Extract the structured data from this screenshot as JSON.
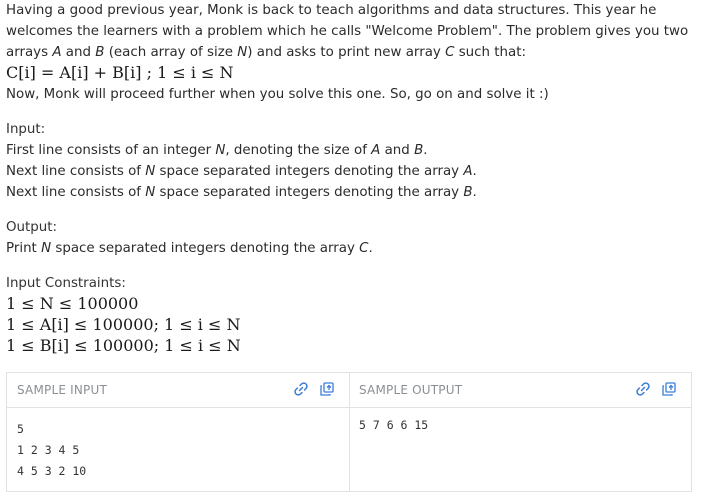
{
  "statement": {
    "line1": "Having a good previous year, Monk is back to teach algorithms and data structures. This year he",
    "line2": "welcomes the learners with a problem which he calls \"Welcome Problem\". The problem gives you two",
    "line3_a": "arrays ",
    "line3_A": "A",
    "line3_b": " and ",
    "line3_B": "B",
    "line3_c": " (each array of size ",
    "line3_N": "N",
    "line3_d": ") and asks to print new array ",
    "line3_C": "C",
    "line3_e": " such that:",
    "formula": "C[i] = A[i] + B[i] ; 1 ≤ i ≤ N",
    "line5": "Now, Monk will proceed further when you solve this one. So, go on and solve it :)"
  },
  "input_section": {
    "heading": "Input:",
    "line1_a": "First line consists of an integer ",
    "line1_N": "N",
    "line1_b": ", denoting the size of ",
    "line1_A": "A",
    "line1_c": " and ",
    "line1_B": "B",
    "line1_d": ".",
    "line2_a": "Next line consists of ",
    "line2_N": "N",
    "line2_b": " space separated integers denoting the array ",
    "line2_A": "A",
    "line2_c": ".",
    "line3_a": "Next line consists of ",
    "line3_N": "N",
    "line3_b": " space separated integers denoting the array ",
    "line3_B": "B",
    "line3_c": "."
  },
  "output_section": {
    "heading": "Output:",
    "line_a": "Print ",
    "line_N": "N",
    "line_b": " space separated integers denoting the array ",
    "line_C": "C",
    "line_c": "."
  },
  "constraints": {
    "heading": "Input Constraints:",
    "c1": "1 ≤ N ≤ 100000",
    "c2": "1 ≤ A[i] ≤ 100000; 1 ≤ i ≤ N",
    "c3": "1 ≤ B[i] ≤ 100000; 1 ≤ i ≤ N"
  },
  "sample": {
    "input_label": "SAMPLE INPUT",
    "output_label": "SAMPLE OUTPUT",
    "input_text": "5\n1 2 3 4 5\n4 5 3 2 10",
    "output_text": "5 7 6 6 15",
    "icon_color": "#3b7dd8"
  }
}
